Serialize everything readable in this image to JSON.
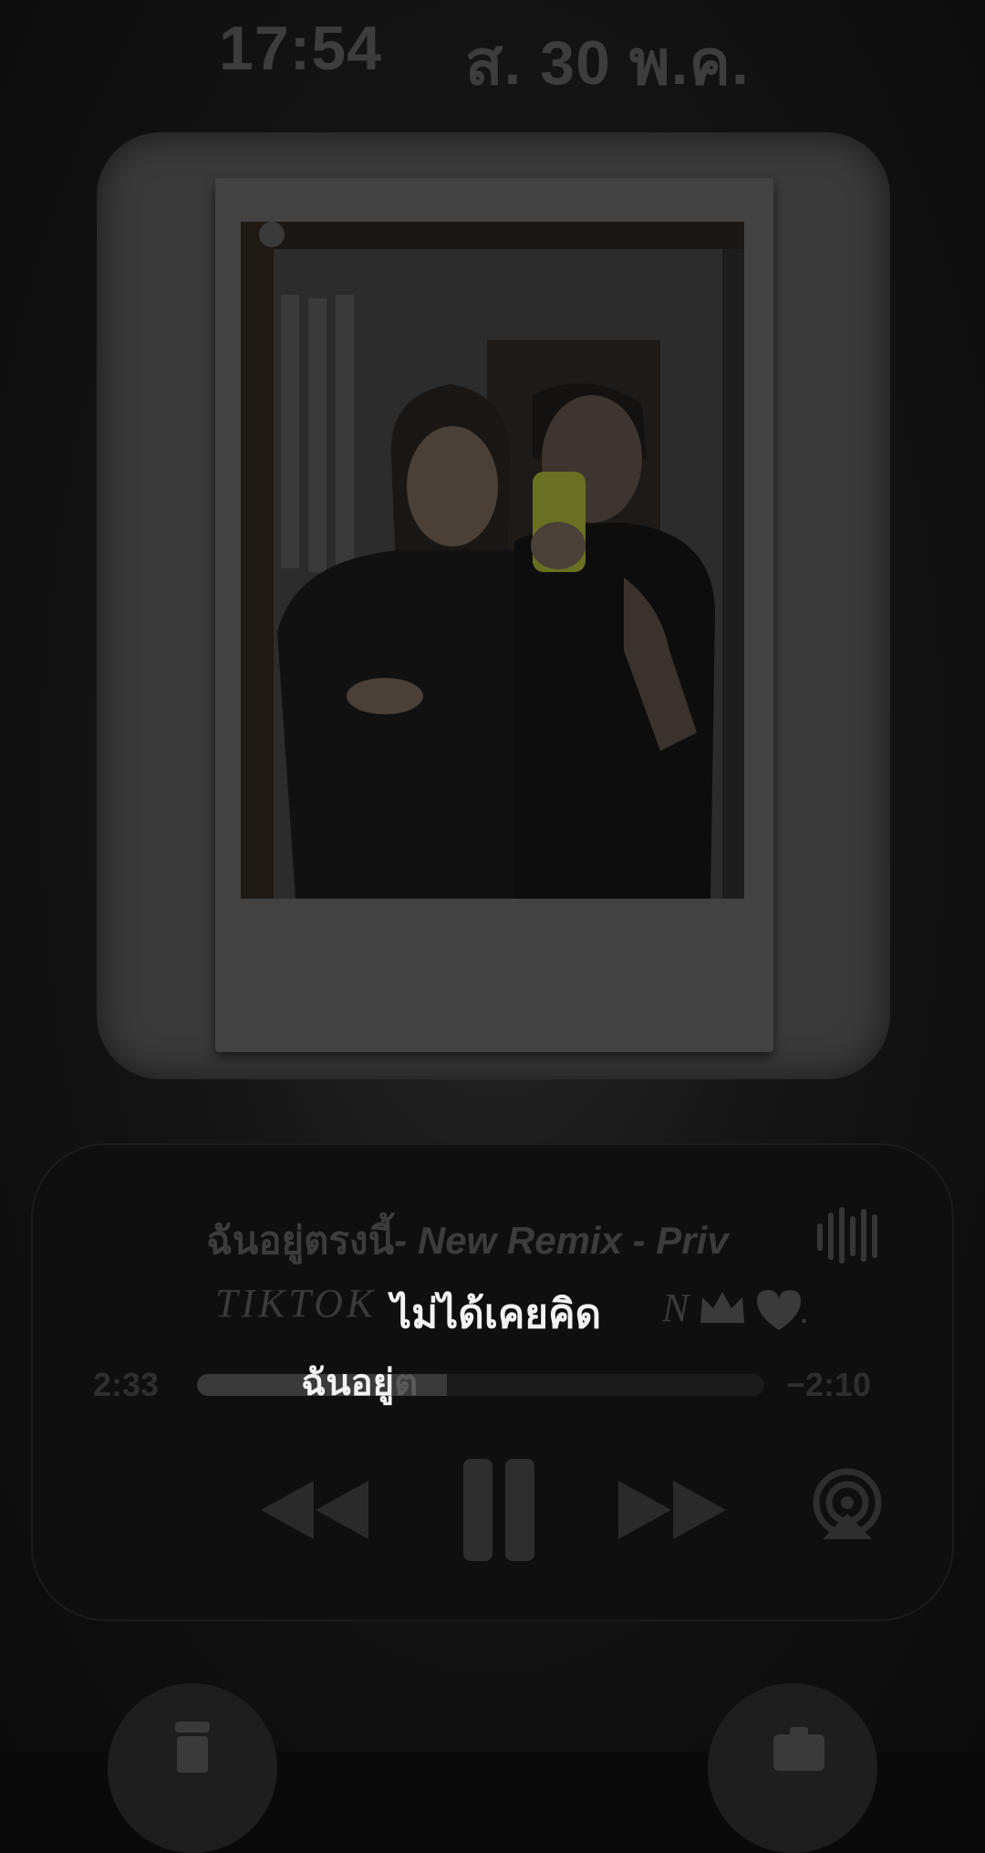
{
  "status": {
    "time": "17:54",
    "date": "ส. 30 พ.ค."
  },
  "photo_widget": {
    "photo_alt": "couple mirror selfie photo"
  },
  "player": {
    "song_title_thai": "ฉันอยู่ตรงนี้",
    "song_title_rest": "- New Remix - Priv",
    "artist_text": "TIKTOK",
    "artist_tail": "N",
    "artist_end": ".",
    "lyric_main": "ไม่ได้เคยคิด",
    "lyric_sub_bright": "ฉันอยู่",
    "lyric_sub_faded": "ต",
    "elapsed": "2:33",
    "remaining": "−2:10",
    "progress_fraction": 0.44,
    "icons": {
      "eq": "waveform-icon",
      "prev": "rewind-icon",
      "pause": "pause-icon",
      "next": "fast-forward-icon",
      "airplay": "airplay-icon"
    }
  },
  "shortcuts": {
    "left": "flashlight-icon",
    "right": "camera-icon"
  }
}
